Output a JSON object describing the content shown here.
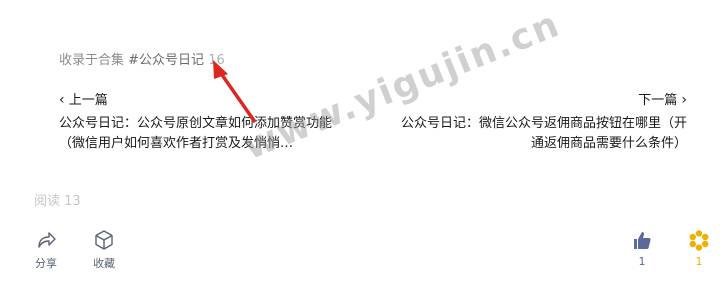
{
  "collection": {
    "label": "收录于合集",
    "tag": "#公众号日记",
    "count": "16"
  },
  "prev": {
    "nav_label": "上一篇",
    "title": "公众号日记：公众号原创文章如何添加赞赏功能（微信用户如何喜欢作者打赏及发悄悄…"
  },
  "next": {
    "nav_label": "下一篇",
    "title": "公众号日记：微信公众号返佣商品按钮在哪里（开通返佣商品需要什么条件）"
  },
  "read": "阅读 13",
  "actions": {
    "share": "分享",
    "favorite": "收藏",
    "like_count": "1",
    "zan_count": "1"
  },
  "watermark": "www.yigujin.cn",
  "colors": {
    "arrow": "#e0251e",
    "like": "#5a6a9a",
    "zan": "#f0b000"
  }
}
